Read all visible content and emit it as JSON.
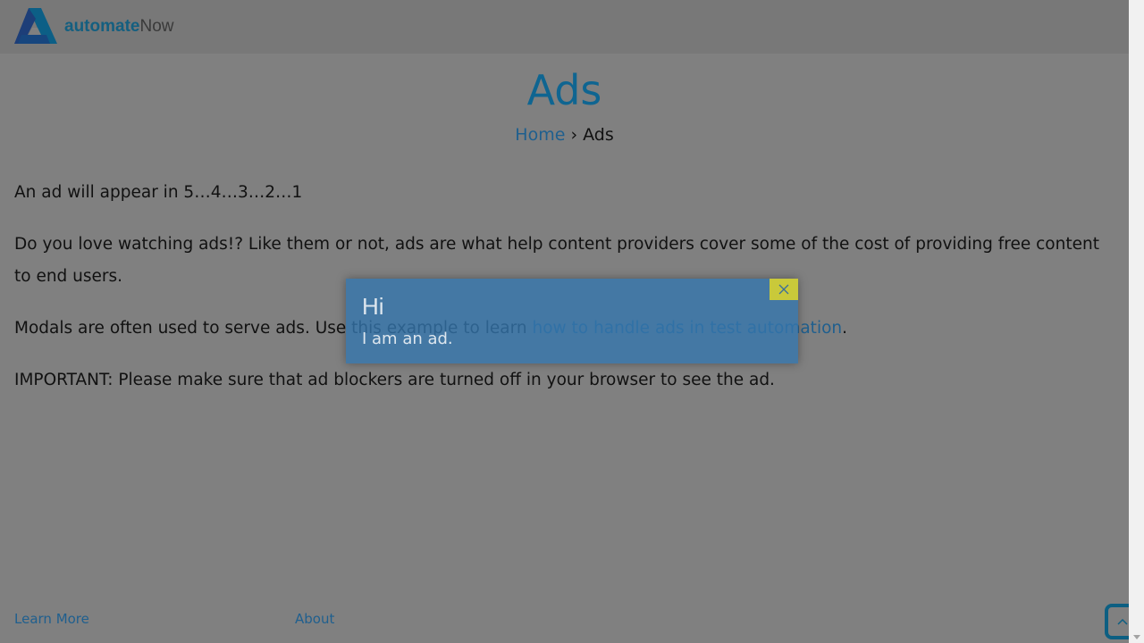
{
  "header": {
    "logo_bold": "automate",
    "logo_light": "Now"
  },
  "page": {
    "title": "Ads"
  },
  "breadcrumb": {
    "home": "Home",
    "separator": "›",
    "current": "Ads"
  },
  "content": {
    "p1": "An ad will appear in 5…4…3…2…1",
    "p2": "Do you love watching ads!? Like them or not, ads are what help content providers cover some of the cost of providing free content to end users.",
    "p3_before": "Modals are often used to serve ads. Use this example to learn ",
    "p3_link": "how to handle ads in test automation",
    "p3_after": ".",
    "p4": "IMPORTANT: Please make sure that ad blockers are turned off in your browser to see the ad."
  },
  "footer": {
    "learn_more": "Learn More",
    "about": "About"
  },
  "modal": {
    "title": "Hi",
    "body": "I am an ad.",
    "close_icon": "close-x",
    "close_bg": "#c9c93a",
    "bg": "#3c76a8"
  },
  "back_to_top": {
    "icon": "chevron-up"
  }
}
